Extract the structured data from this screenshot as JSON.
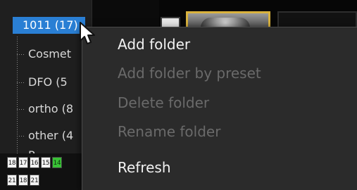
{
  "tree": {
    "root_label": "1011 (17)",
    "items": [
      {
        "label": "Cosmet"
      },
      {
        "label": "DFO (5"
      },
      {
        "label": "ortho (8"
      },
      {
        "label": "other (4"
      },
      {
        "label": "P"
      }
    ]
  },
  "mini_toolbar": {
    "row1": [
      {
        "label": "18"
      },
      {
        "label": "17"
      },
      {
        "label": "16"
      },
      {
        "label": "15"
      },
      {
        "label": "14",
        "state": "active"
      }
    ],
    "row2": [
      {
        "label": "21"
      },
      {
        "label": "18"
      },
      {
        "label": "21"
      }
    ]
  },
  "context_menu": {
    "items": [
      {
        "label": "Add folder",
        "enabled": true
      },
      {
        "label": "Add folder by preset",
        "enabled": false
      },
      {
        "label": "Delete folder",
        "enabled": false
      },
      {
        "label": "Rename folder",
        "enabled": false
      },
      {
        "label": "Refresh",
        "enabled": true
      }
    ]
  },
  "colors": {
    "selection": "#2a7fd4",
    "menu_bg": "#2b2b2b",
    "thumb_border": "#d9b23d",
    "active_button": "#39c236"
  },
  "icons": {
    "cursor": "mouse-pointer-icon"
  }
}
